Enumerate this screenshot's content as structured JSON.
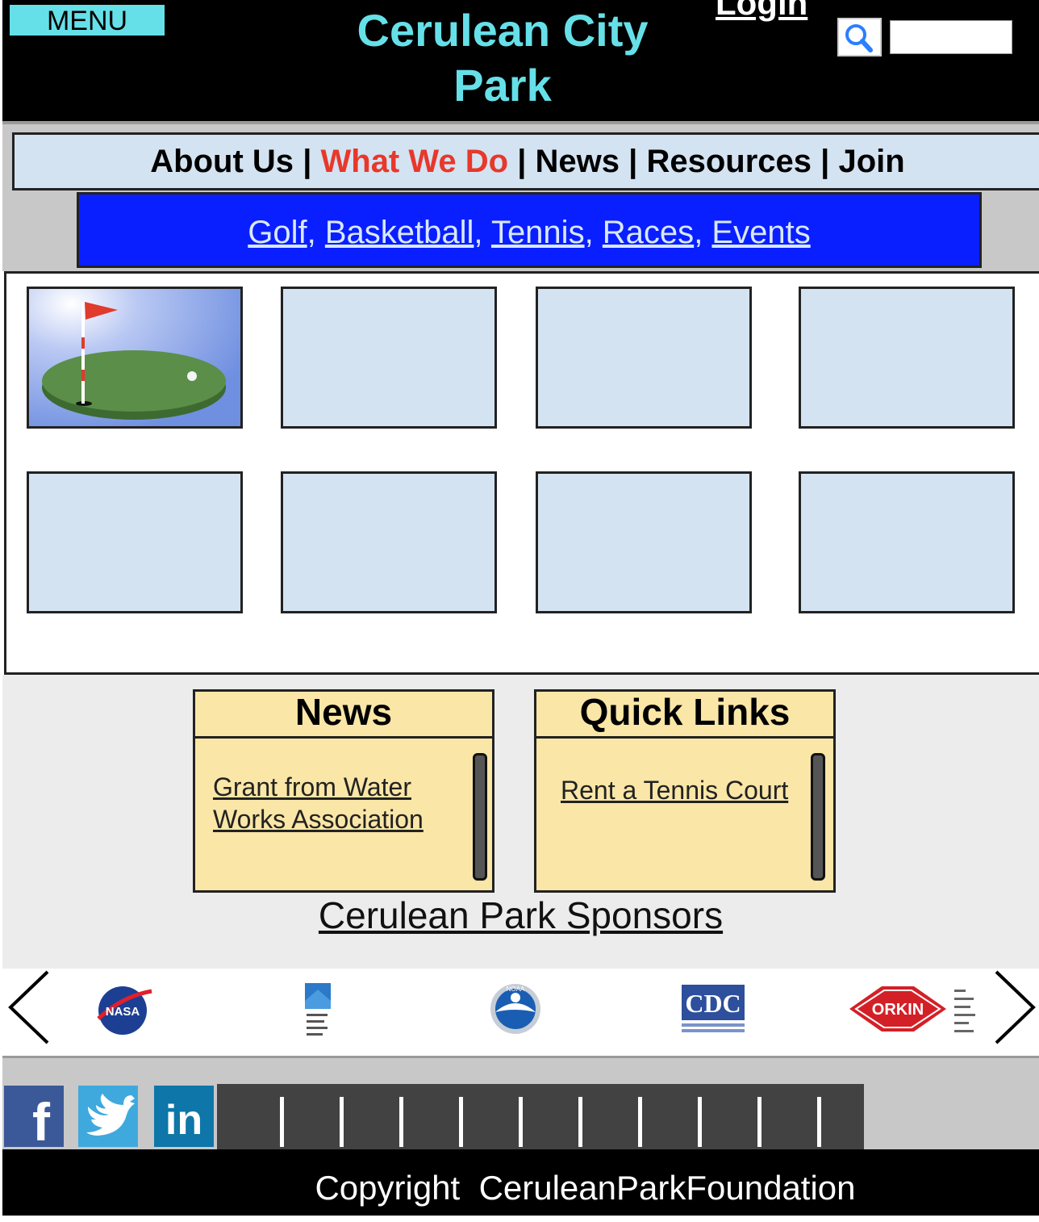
{
  "header": {
    "menu_label": "MENU",
    "title": "Cerulean City Park",
    "login_label": "Login",
    "search_placeholder": ""
  },
  "main_nav": {
    "items": [
      "About Us",
      "What We Do",
      "News",
      "Resources",
      "Join"
    ],
    "separator": "|",
    "active": "What We Do"
  },
  "sub_nav": {
    "items": [
      "Golf",
      "Basketball",
      "Tennis",
      "Races",
      "Events"
    ],
    "separator": ","
  },
  "tiles": {
    "first_image": "golf-green-flag"
  },
  "news": {
    "title": "News",
    "items": [
      "Grant from Water Works Association"
    ]
  },
  "quick_links": {
    "title": "Quick Links",
    "items": [
      "Rent a Tennis Court"
    ]
  },
  "sponsors": {
    "title": "Cerulean Park Sponsors",
    "logos": [
      "NASA",
      "",
      "NOAA",
      "CDC",
      "ORKIN"
    ]
  },
  "social": {
    "icons": [
      "facebook-icon",
      "twitter-icon",
      "linkedin-icon"
    ],
    "facebook": "f",
    "linkedin": "in"
  },
  "footer": {
    "copyright": "Copyright",
    "owner": "CeruleanParkFoundation"
  },
  "colors": {
    "header_bg": "#000000",
    "accent_cyan": "#66e0e8",
    "nav_bg": "#d4e3f1",
    "active_red": "#e8372b",
    "subnav_blue": "#0a1fff",
    "panel_yellow": "#fae6a6"
  }
}
